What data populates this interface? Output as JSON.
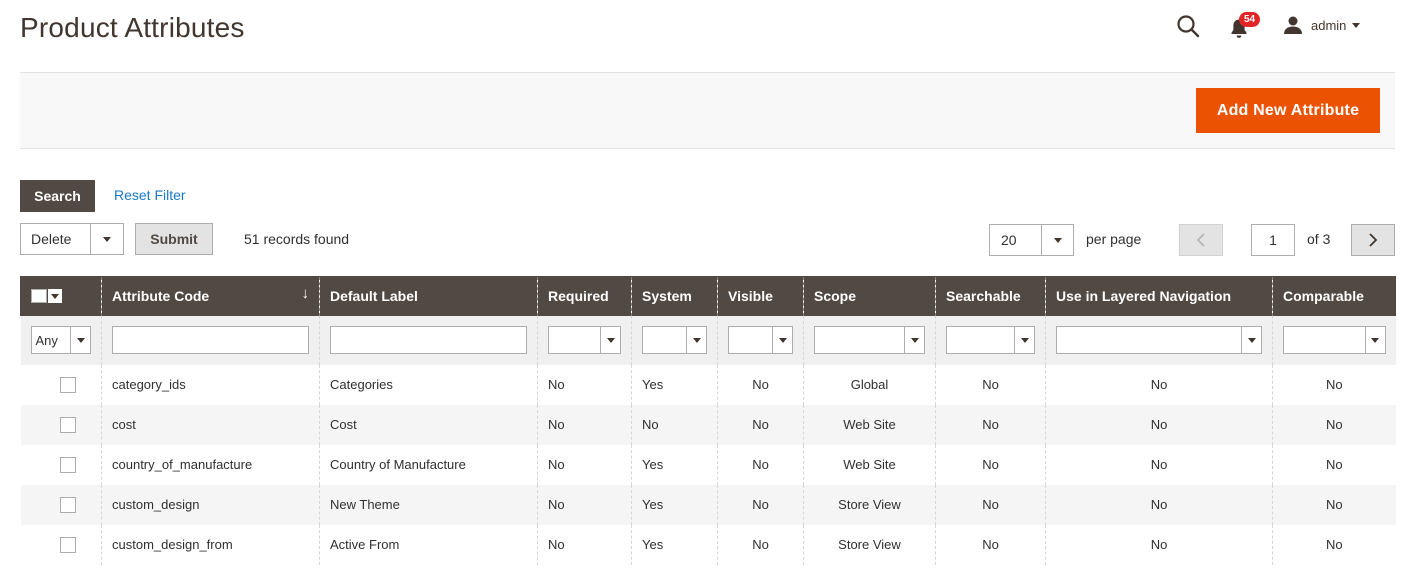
{
  "header": {
    "title": "Product Attributes",
    "search_icon": "search-icon",
    "notifications_count": "54",
    "user_name": "admin"
  },
  "actions": {
    "add_new_label": "Add New Attribute"
  },
  "filters": {
    "search_label": "Search",
    "reset_label": "Reset Filter"
  },
  "mass_action": {
    "selected": "Delete",
    "submit_label": "Submit",
    "records_found": "51 records found"
  },
  "pager": {
    "per_page_value": "20",
    "per_page_label": "per page",
    "current_page": "1",
    "of_pages": "of 3"
  },
  "grid": {
    "columns": [
      "Attribute Code",
      "Default Label",
      "Required",
      "System",
      "Visible",
      "Scope",
      "Searchable",
      "Use in Layered Navigation",
      "Comparable"
    ],
    "sort_arrow": "↓",
    "filter_any": "Any",
    "rows": [
      [
        "category_ids",
        "Categories",
        "No",
        "Yes",
        "No",
        "Global",
        "No",
        "No",
        "No"
      ],
      [
        "cost",
        "Cost",
        "No",
        "No",
        "No",
        "Web Site",
        "No",
        "No",
        "No"
      ],
      [
        "country_of_manufacture",
        "Country of Manufacture",
        "No",
        "Yes",
        "No",
        "Web Site",
        "No",
        "No",
        "No"
      ],
      [
        "custom_design",
        "New Theme",
        "No",
        "Yes",
        "No",
        "Store View",
        "No",
        "No",
        "No"
      ],
      [
        "custom_design_from",
        "Active From",
        "No",
        "Yes",
        "No",
        "Store View",
        "No",
        "No",
        "No"
      ]
    ]
  },
  "colors": {
    "accent": "#eb5202",
    "header_bg": "#514943",
    "link": "#1979c3",
    "badge": "#e22626"
  }
}
